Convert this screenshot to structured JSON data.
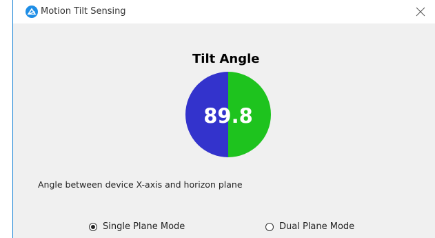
{
  "window": {
    "title": "Motion Tilt Sensing",
    "accent_color": "#1a83d6",
    "close_icon": "close-icon"
  },
  "main": {
    "heading": "Tilt Angle",
    "gauge": {
      "value": "89.8",
      "left_color": "#3333cc",
      "right_color": "#1ec31e"
    },
    "description": "Angle between device X-axis and horizon plane",
    "modes": [
      {
        "label": "Single Plane Mode",
        "selected": true
      },
      {
        "label": "Dual Plane Mode",
        "selected": false
      }
    ]
  }
}
